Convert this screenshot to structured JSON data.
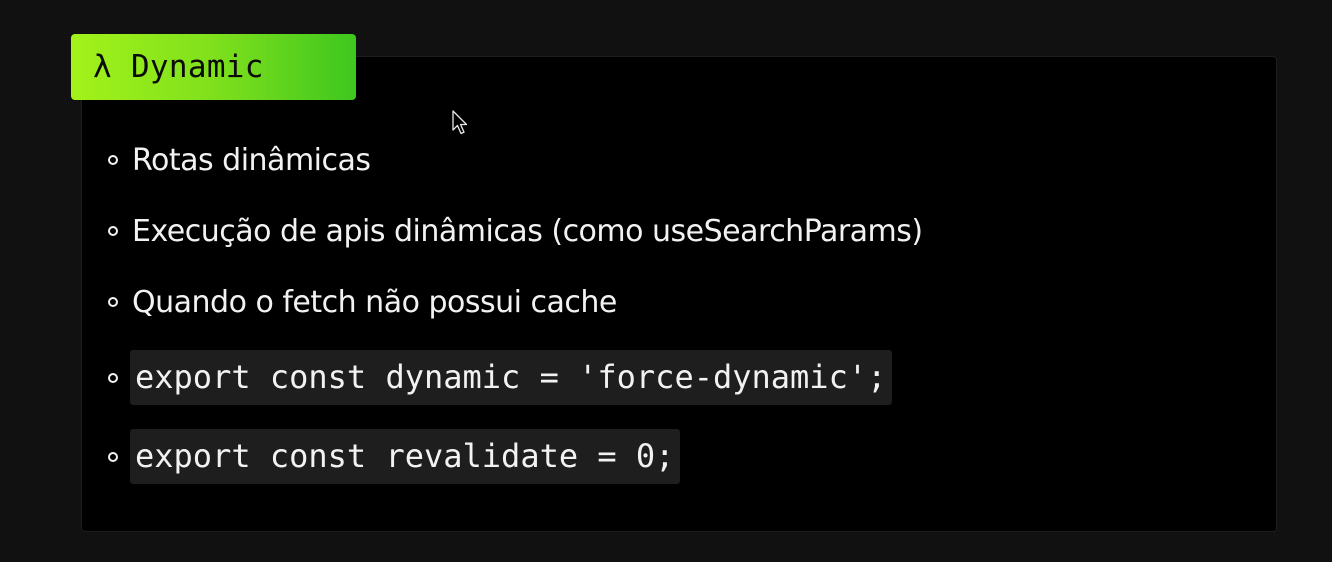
{
  "badge": {
    "symbol": "λ",
    "label": "Dynamic",
    "gradient_colors": [
      "#a3f21a",
      "#3ec71f"
    ]
  },
  "items": [
    {
      "kind": "text",
      "text": "Rotas dinâmicas"
    },
    {
      "kind": "text",
      "text": "Execução de apis dinâmicas (como useSearchParams)"
    },
    {
      "kind": "text",
      "text": "Quando o fetch não possui cache"
    },
    {
      "kind": "code",
      "text": "export const dynamic = 'force-dynamic';"
    },
    {
      "kind": "code",
      "text": "export const revalidate = 0;"
    }
  ],
  "cursor": {
    "icon": "arrow-cursor-icon"
  }
}
